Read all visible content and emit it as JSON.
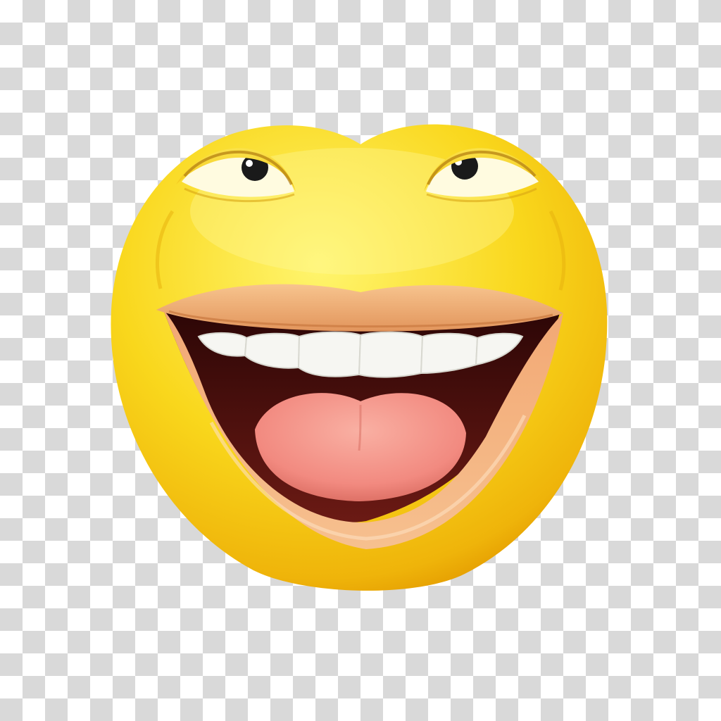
{
  "image": {
    "subject": "laughing-face-emoji",
    "background": "transparency-checkerboard",
    "colors": {
      "checker_light": "#ffffff",
      "checker_dark": "#d9d9d9",
      "face_highlight": "#fff36b",
      "face_main": "#f9d71c",
      "face_shadow": "#e9a400",
      "lip": "#f4b27a",
      "lip_dark": "#d98850",
      "mouth_inside": "#4a0f0f",
      "teeth": "#f6f6f2",
      "tongue": "#f28a80",
      "pupil": "#1a1a1a"
    }
  }
}
